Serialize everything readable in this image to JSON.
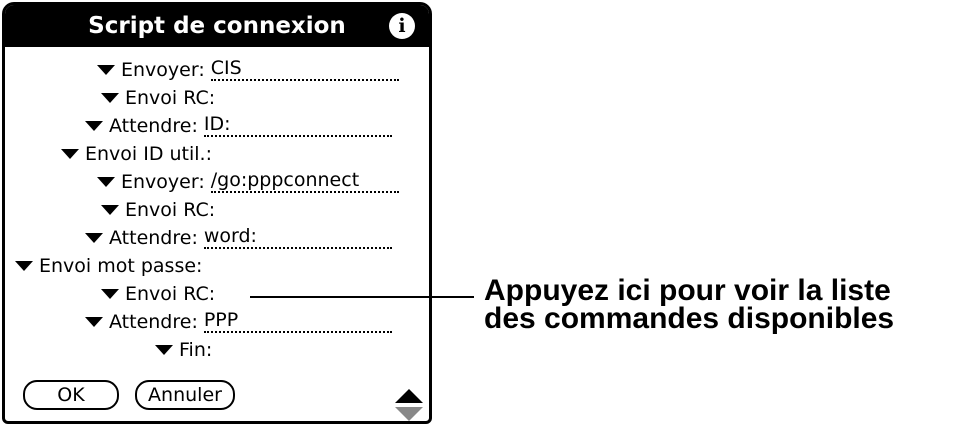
{
  "dialog": {
    "title": "Script de connexion",
    "info_icon": "i",
    "rows": [
      {
        "command": "Envoyer:",
        "param": "CIS"
      },
      {
        "command": "Envoi RC:",
        "param": ""
      },
      {
        "command": "Attendre:",
        "param": "ID:"
      },
      {
        "command": "Envoi ID util.:",
        "param": ""
      },
      {
        "command": "Envoyer:",
        "param": "/go:pppconnect"
      },
      {
        "command": "Envoi RC:",
        "param": ""
      },
      {
        "command": "Attendre:",
        "param": "word:"
      },
      {
        "command": "Envoi mot passe:",
        "param": ""
      },
      {
        "command": "Envoi RC:",
        "param": ""
      },
      {
        "command": "Attendre:",
        "param": "PPP"
      },
      {
        "command": "Fin:",
        "param": ""
      }
    ],
    "ok_label": "OK",
    "cancel_label": "Annuler"
  },
  "callout": {
    "line1": "Appuyez ici pour voir la liste",
    "line2": "des commandes disponibles"
  },
  "icons": {
    "dropdown": "triangle-down-icon",
    "info": "info-icon",
    "scroll": "scroll-arrows-icon"
  }
}
